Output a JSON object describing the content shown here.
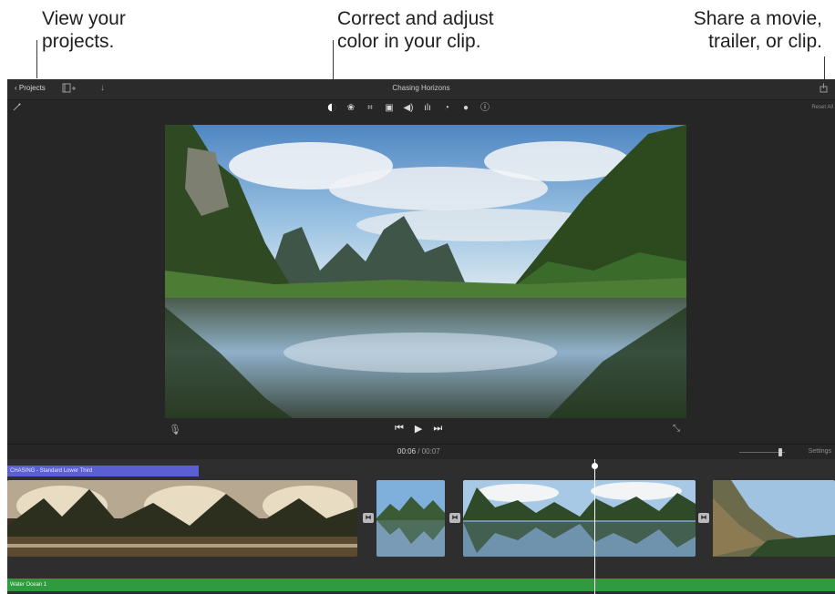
{
  "callouts": {
    "projects": [
      "View your",
      "projects."
    ],
    "color": [
      "Correct and adjust",
      "color in your clip."
    ],
    "share": [
      "Share a movie,",
      "trailer, or clip."
    ]
  },
  "topbar": {
    "projects_label": "Projects",
    "title": "Chasing Horizons",
    "icons": [
      "media-browser-icon",
      "import-icon",
      "share-icon"
    ]
  },
  "toolbar": {
    "reset_label": "Reset All",
    "tools": [
      "color-balance-icon",
      "color-correction-icon",
      "crop-icon",
      "stabilization-icon",
      "volume-icon",
      "equalizer-icon",
      "speed-icon",
      "noise-reduction-icon",
      "clip-info-icon"
    ]
  },
  "playback": {
    "current_time": "00:06",
    "separator": "/",
    "total_time": "00:07",
    "settings_label": "Settings"
  },
  "timeline": {
    "title_clip_label": "CHASING - Standard Lower Third",
    "audio_clip_label": "Water Ocean 1"
  },
  "colors": {
    "app_background": "#262626",
    "title_track": "#5b5fd4",
    "audio_track": "#2f9a3e"
  }
}
